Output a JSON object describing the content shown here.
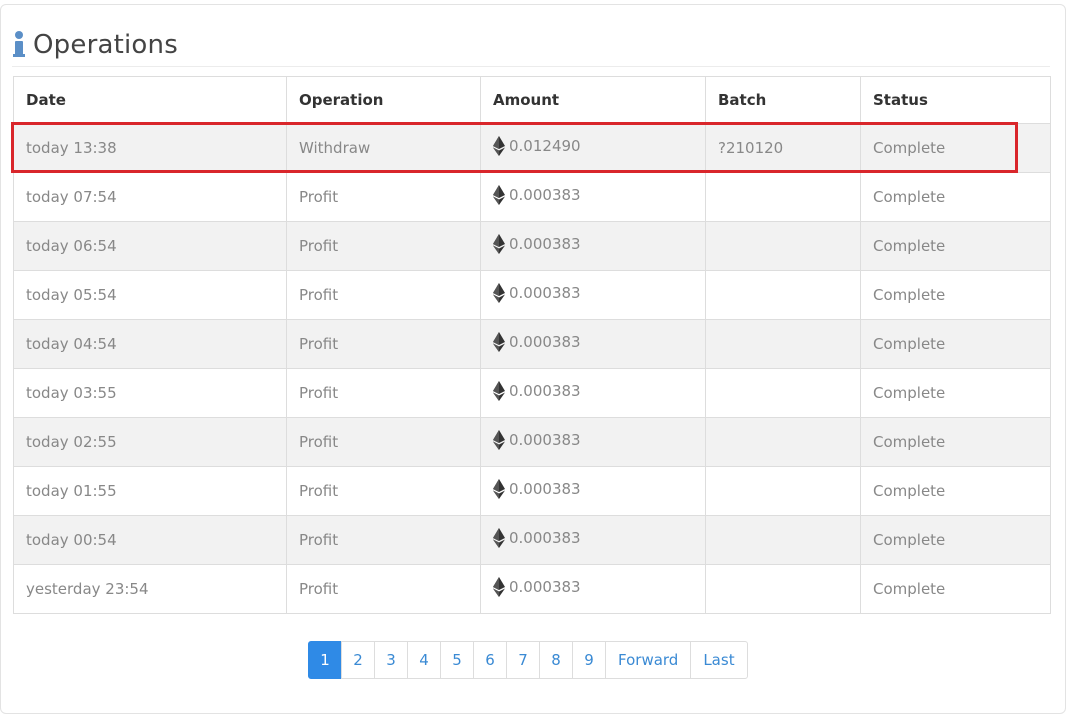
{
  "panel": {
    "title": "Operations",
    "icon": "info-icon",
    "accent_color": "#5b8fc7"
  },
  "table": {
    "headers": [
      "Date",
      "Operation",
      "Amount",
      "Batch",
      "Status"
    ],
    "rows": [
      {
        "date": "today 13:38",
        "operation": "Withdraw",
        "amount": "0.012490",
        "batch": "?210120",
        "status": "Complete",
        "highlighted": true
      },
      {
        "date": "today 07:54",
        "operation": "Profit",
        "amount": "0.000383",
        "batch": "",
        "status": "Complete"
      },
      {
        "date": "today 06:54",
        "operation": "Profit",
        "amount": "0.000383",
        "batch": "",
        "status": "Complete"
      },
      {
        "date": "today 05:54",
        "operation": "Profit",
        "amount": "0.000383",
        "batch": "",
        "status": "Complete"
      },
      {
        "date": "today 04:54",
        "operation": "Profit",
        "amount": "0.000383",
        "batch": "",
        "status": "Complete"
      },
      {
        "date": "today 03:55",
        "operation": "Profit",
        "amount": "0.000383",
        "batch": "",
        "status": "Complete"
      },
      {
        "date": "today 02:55",
        "operation": "Profit",
        "amount": "0.000383",
        "batch": "",
        "status": "Complete"
      },
      {
        "date": "today 01:55",
        "operation": "Profit",
        "amount": "0.000383",
        "batch": "",
        "status": "Complete"
      },
      {
        "date": "today 00:54",
        "operation": "Profit",
        "amount": "0.000383",
        "batch": "",
        "status": "Complete"
      },
      {
        "date": "yesterday 23:54",
        "operation": "Profit",
        "amount": "0.000383",
        "batch": "",
        "status": "Complete"
      }
    ],
    "amount_icon": "ethereum-icon",
    "highlight_color": "#d9262b"
  },
  "pagination": {
    "pages": [
      "1",
      "2",
      "3",
      "4",
      "5",
      "6",
      "7",
      "8",
      "9"
    ],
    "current": "1",
    "forward_label": "Forward",
    "last_label": "Last",
    "active_color": "#2f8ae6",
    "link_color": "#3a8ad4"
  }
}
